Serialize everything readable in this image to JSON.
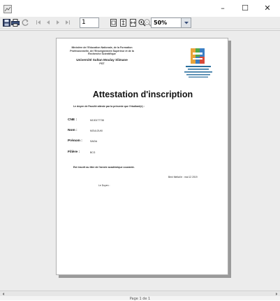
{
  "window": {
    "minimize": "–",
    "maximize": "☐",
    "close": "✕"
  },
  "toolbar": {
    "page_number": "1",
    "zoom": "50%",
    "icons": [
      "save-icon",
      "print-icon",
      "reload-icon",
      "first-page-icon",
      "previous-page-icon",
      "next-page-icon",
      "last-page-icon",
      "actual-size-icon",
      "fit-page-icon",
      "fit-width-icon",
      "zoom-in-icon",
      "zoom-out-icon"
    ]
  },
  "document": {
    "ministry": "Ministère de l'Education Nationale, de la Formation Professionnelle, de l'Enseignement Supérieur et de la Recherche Scientifique",
    "university": "Université Sultan Moulay Slimane",
    "faculty": "FST",
    "title": "Attestation d'inscription",
    "intro": "Le doyen de Faculté atteste par la présente que l'étudiant(e) :",
    "fields": [
      {
        "label": "CNE :",
        "value": "M130177738"
      },
      {
        "label": "Nom :",
        "value": "MOULOUKI"
      },
      {
        "label": "Prénom :",
        "value": "SAIDA"
      },
      {
        "label": "Filière :",
        "value": "BCG"
      }
    ],
    "enrolled": "Est inscrit au titre de l'année académique courante.",
    "place_date": "Beni Mellal le : mai 12 2019",
    "signature": "Le Doyen :"
  },
  "status": {
    "page_label": "Page 1 de 1"
  }
}
